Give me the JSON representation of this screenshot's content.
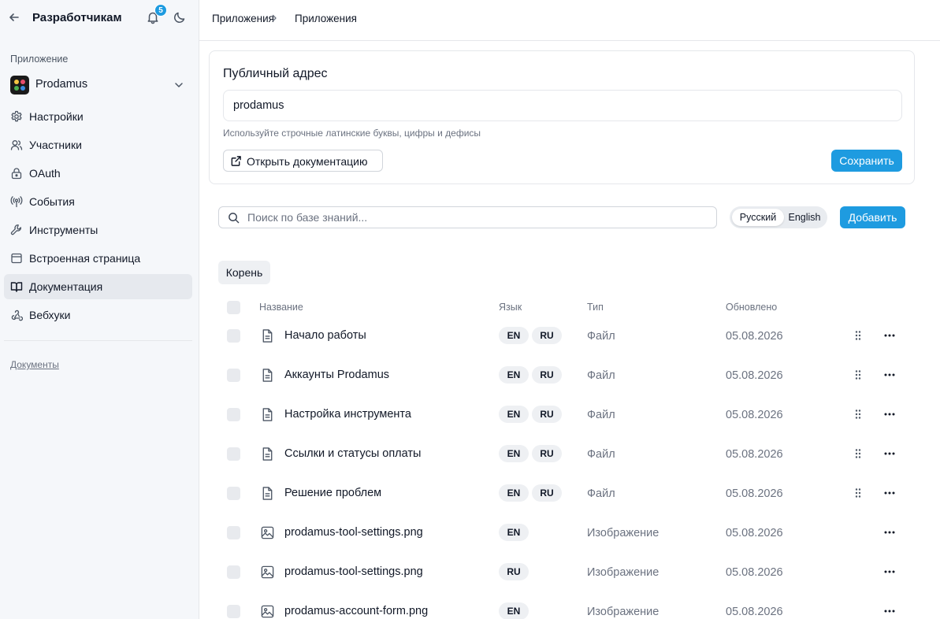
{
  "sidebar": {
    "title": "Разработчикам",
    "notification_count": "5",
    "section_label": "Приложение",
    "app_name": "Prodamus",
    "items": [
      {
        "label": "Настройки",
        "icon": "gear-icon"
      },
      {
        "label": "Участники",
        "icon": "users-icon"
      },
      {
        "label": "OAuth",
        "icon": "lock-icon"
      },
      {
        "label": "События",
        "icon": "broadcast-icon"
      },
      {
        "label": "Инструменты",
        "icon": "wrench-icon"
      },
      {
        "label": "Встроенная страница",
        "icon": "window-icon"
      },
      {
        "label": "Документация",
        "icon": "book-icon",
        "active": true
      },
      {
        "label": "Вебхуки",
        "icon": "webhook-icon"
      }
    ],
    "footer_link": "Документы"
  },
  "breadcrumb": [
    "Приложения",
    "Приложения"
  ],
  "public_address": {
    "title": "Публичный адрес",
    "value": "prodamus",
    "hint": "Используйте строчные латинские буквы, цифры и дефисы",
    "open_docs_label": "Открыть документацию",
    "save_label": "Сохранить"
  },
  "toolbar": {
    "search_placeholder": "Поиск по базе знаний...",
    "lang_ru": "Русский",
    "lang_en": "English",
    "add_label": "Добавить"
  },
  "folder": "Корень",
  "table": {
    "columns": [
      "Название",
      "Язык",
      "Тип",
      "Обновлено"
    ],
    "rows": [
      {
        "name": "Начало работы",
        "icon": "file-icon",
        "langs": [
          "EN",
          "RU"
        ],
        "type": "Файл",
        "updated": "05.08.2026",
        "draggable": true
      },
      {
        "name": "Аккаунты Prodamus",
        "icon": "file-icon",
        "langs": [
          "EN",
          "RU"
        ],
        "type": "Файл",
        "updated": "05.08.2026",
        "draggable": true
      },
      {
        "name": "Настройка инструмента",
        "icon": "file-icon",
        "langs": [
          "EN",
          "RU"
        ],
        "type": "Файл",
        "updated": "05.08.2026",
        "draggable": true
      },
      {
        "name": "Ссылки и статусы оплаты",
        "icon": "file-icon",
        "langs": [
          "EN",
          "RU"
        ],
        "type": "Файл",
        "updated": "05.08.2026",
        "draggable": true
      },
      {
        "name": "Решение проблем",
        "icon": "file-icon",
        "langs": [
          "EN",
          "RU"
        ],
        "type": "Файл",
        "updated": "05.08.2026",
        "draggable": true
      },
      {
        "name": "prodamus-tool-settings.png",
        "icon": "image-icon",
        "langs": [
          "EN"
        ],
        "type": "Изображение",
        "updated": "05.08.2026",
        "draggable": false
      },
      {
        "name": "prodamus-tool-settings.png",
        "icon": "image-icon",
        "langs": [
          "RU"
        ],
        "type": "Изображение",
        "updated": "05.08.2026",
        "draggable": false
      },
      {
        "name": "prodamus-account-form.png",
        "icon": "image-icon",
        "langs": [
          "EN"
        ],
        "type": "Изображение",
        "updated": "05.08.2026",
        "draggable": false
      }
    ]
  },
  "colors": {
    "accent": "#1e9be0",
    "sidebar_bg": "#f5f7fa",
    "active_item_bg": "#e6e9ee"
  }
}
